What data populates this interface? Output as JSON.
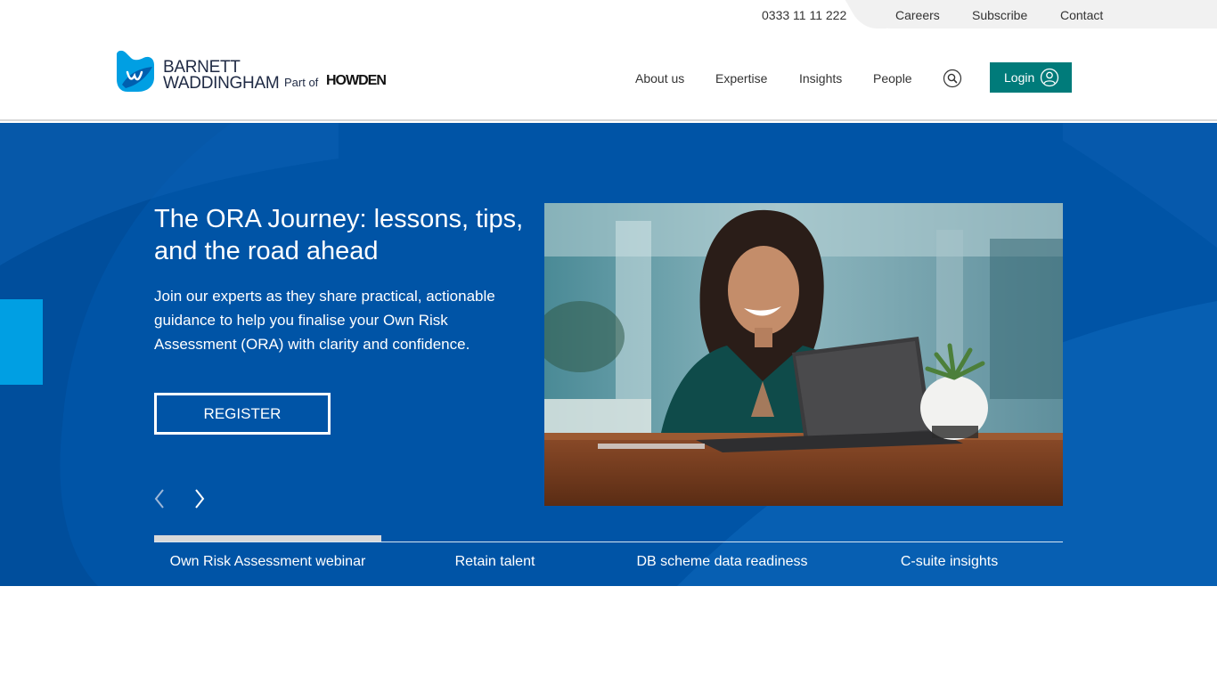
{
  "utility": {
    "phone": "0333 11 11 222",
    "links": [
      "Careers",
      "Subscribe",
      "Contact"
    ]
  },
  "logo": {
    "line1": "BARNETT",
    "line2": "WADDINGHAM",
    "part_of": "Part of",
    "partner": "HOWDEN"
  },
  "nav": {
    "items": [
      "About us",
      "Expertise",
      "Insights",
      "People"
    ],
    "search_icon": "search-icon",
    "login_label": "Login",
    "login_icon": "user-icon"
  },
  "hero": {
    "title": "The ORA Journey: lessons, tips, and the road ahead",
    "description": "Join our experts as they share practical, actionable guidance to help you finalise your Own Risk Assessment (ORA) with clarity and confidence.",
    "cta": "REGISTER",
    "prev_icon": "chevron-left-icon",
    "next_icon": "chevron-right-icon",
    "image": "woman-smiling-at-laptop-photo"
  },
  "tabs": {
    "items": [
      "Own Risk Assessment webinar",
      "Retain talent",
      "DB scheme data readiness",
      "C-suite insights"
    ],
    "active_index": 0
  },
  "colors": {
    "hero_blue": "#0054a6",
    "accent_cyan": "#009fe3",
    "login_teal": "#007b7a"
  }
}
